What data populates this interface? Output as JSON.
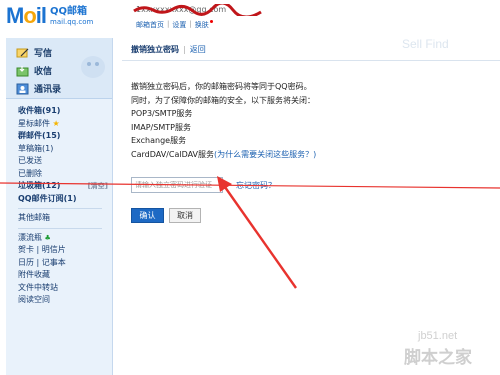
{
  "header": {
    "logo_mail": "Mail",
    "logo_cn": "QQ邮箱",
    "logo_url": "mail.qq.com",
    "account": "1xxxxxxxxxx@qq.com",
    "links": [
      "邮箱首页",
      "设置",
      "换肤"
    ]
  },
  "sidebar": {
    "actions": [
      "写信",
      "收信",
      "通讯录"
    ],
    "folders_a": [
      {
        "label": "收件箱(91)",
        "bold": true
      },
      {
        "label": "星标邮件",
        "bold": false,
        "star": "★"
      },
      {
        "label": "群邮件(15)",
        "bold": true
      },
      {
        "label": "草稿箱(1)",
        "bold": false
      },
      {
        "label": "已发送",
        "bold": false
      },
      {
        "label": "已删除",
        "bold": false
      },
      {
        "label": "垃圾箱(12)",
        "bold": true,
        "extra": "[清空]"
      },
      {
        "label": "QQ邮件订阅(1)",
        "bold": true
      }
    ],
    "folders_b": [
      "其他邮箱"
    ],
    "folders_c": [
      "漂流瓶",
      "贺卡 | 明信片",
      "日历 | 记事本",
      "附件收藏",
      "文件中转站",
      "阅读空间"
    ],
    "plant": "♣"
  },
  "main": {
    "tab_title": "撤销独立密码",
    "tab_back": "返回",
    "lines": [
      "撤销独立密码后，你的邮箱密码将等同于QQ密码。",
      "同时，为了保障你的邮箱的安全，以下服务将关闭：",
      "POP3/SMTP服务",
      "IMAP/SMTP服务",
      "Exchange服务"
    ],
    "carddav": "CardDAV/CalDAV服务",
    "why_link": "(为什么需要关闭这些服务？)",
    "password_placeholder": "请输入独立密码进行验证",
    "forgot_link": "忘记密码？",
    "ok_button": "确认",
    "cancel_button": "取消"
  },
  "watermark": {
    "site": "jb51.net",
    "brand": "脚本之家"
  },
  "colors": {
    "accent": "#1b73d1",
    "annotation": "#e8332e"
  }
}
